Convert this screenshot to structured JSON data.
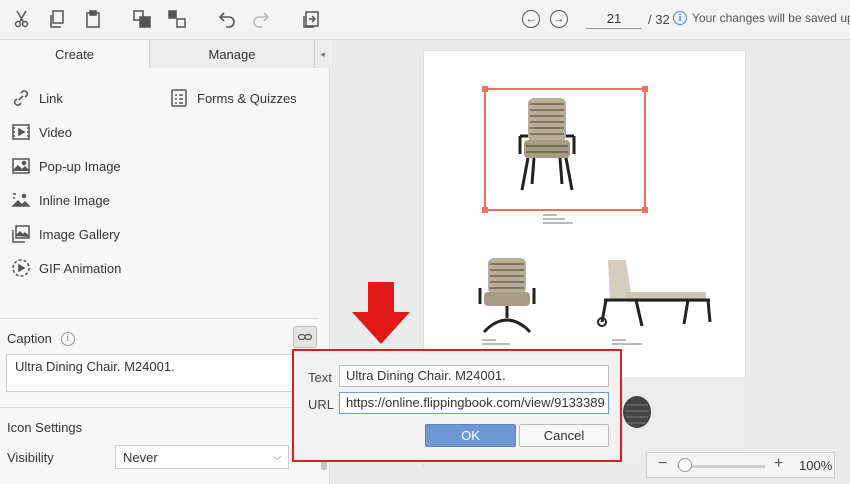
{
  "toolbar": {
    "icons": [
      "cut-icon",
      "copy-icon",
      "paste-icon",
      "bring-forward-icon",
      "send-backward-icon",
      "undo-icon",
      "redo-icon",
      "replace-page-icon"
    ],
    "current_page": "21",
    "total_pages": "/ 32",
    "save_notice": "Your changes will be saved upon"
  },
  "sidebar": {
    "tabs": {
      "create": "Create",
      "manage": "Manage",
      "collapse": "◂"
    },
    "tools": [
      {
        "label": "Link",
        "icon": "link-icon"
      },
      {
        "label": "Forms & Quizzes",
        "icon": "form-icon"
      },
      {
        "label": "Video",
        "icon": "video-icon"
      },
      {
        "label": "Pop-up Image",
        "icon": "image-icon"
      },
      {
        "label": "Inline Image",
        "icon": "inline-image-icon"
      },
      {
        "label": "Image Gallery",
        "icon": "gallery-icon"
      },
      {
        "label": "GIF Animation",
        "icon": "gif-icon"
      }
    ],
    "caption": {
      "label": "Caption",
      "value": "Ultra Dining Chair. M24001."
    },
    "icon_settings": {
      "title": "Icon Settings",
      "visibility_label": "Visibility",
      "visibility_value": "Never"
    }
  },
  "dialog": {
    "text_label": "Text",
    "text_value": "Ultra Dining Chair. M24001.",
    "url_label": "URL",
    "url_value": "https://online.flippingbook.com/view/9133389",
    "ok": "OK",
    "cancel": "Cancel"
  },
  "zoom": {
    "minus": "−",
    "plus": "+",
    "level_percent": 100,
    "value": "100%"
  },
  "colors": {
    "accent": "#6e97d3",
    "highlight": "#d42020",
    "selection": "#f07060"
  }
}
